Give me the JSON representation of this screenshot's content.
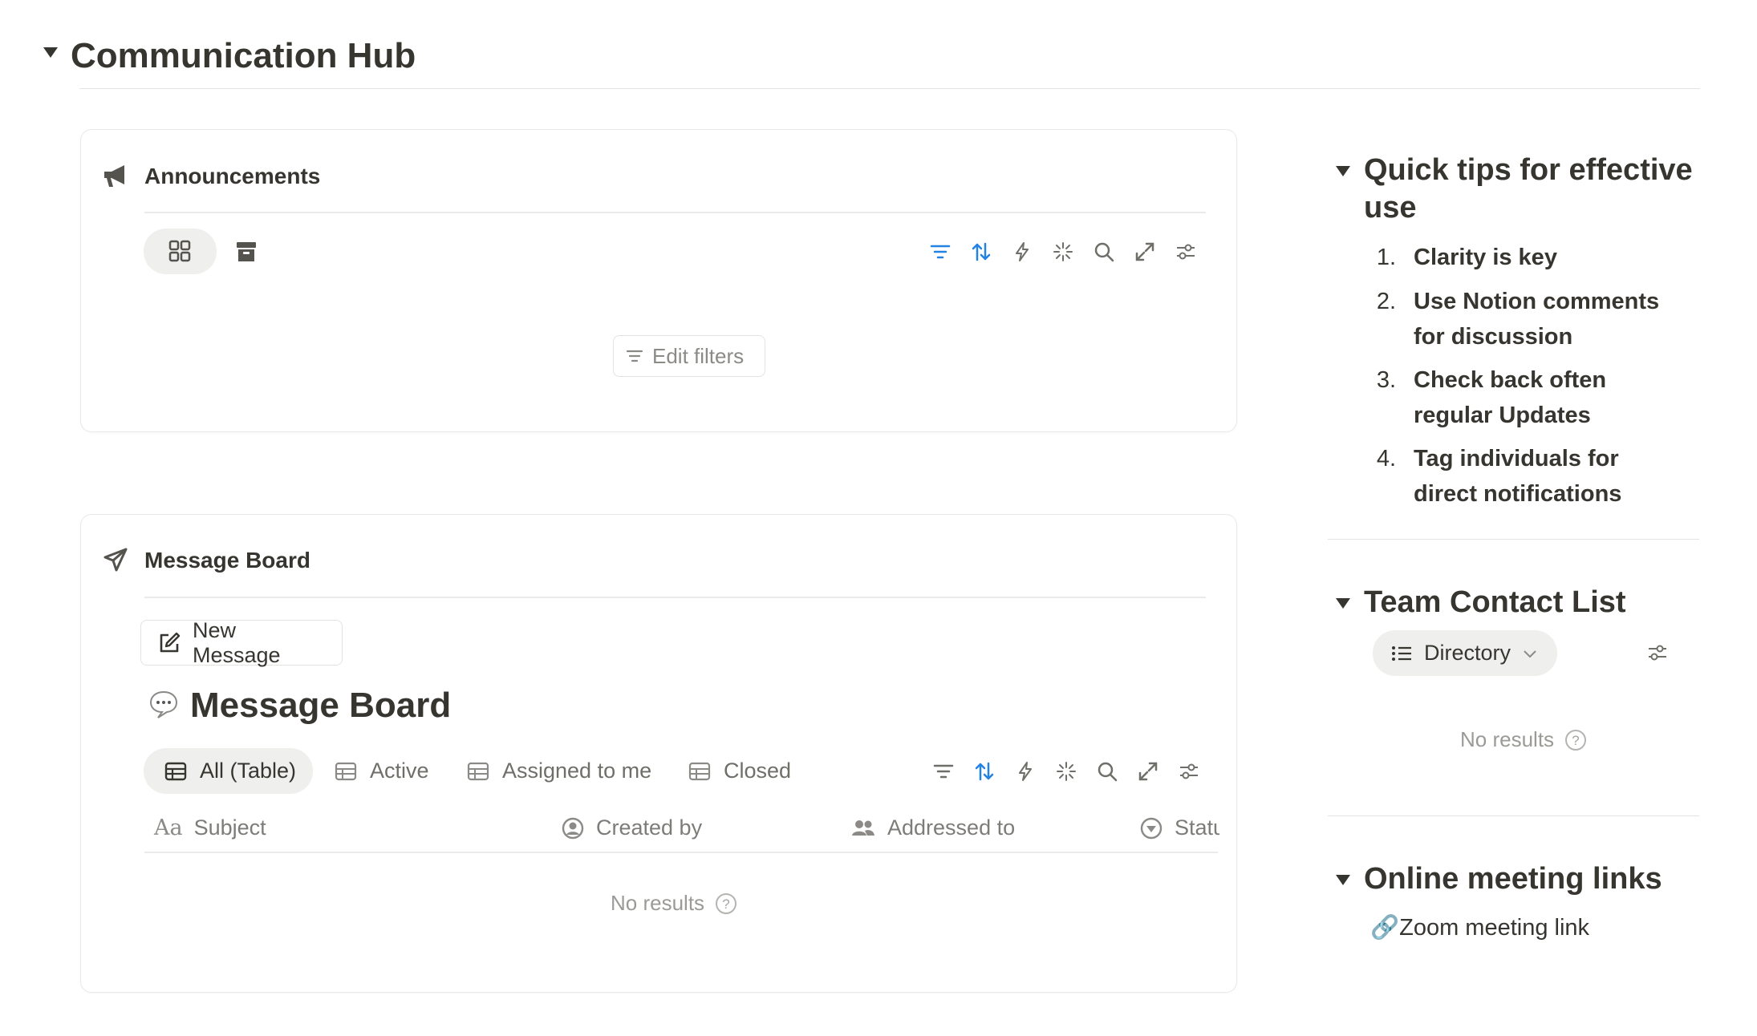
{
  "page": {
    "title": "Communication Hub"
  },
  "announcements": {
    "title": "Announcements",
    "edit_filters_label": "Edit filters"
  },
  "message_board": {
    "title": "Message Board",
    "new_message_label": "New Message",
    "database_title": "Message Board",
    "tabs": [
      {
        "label": "All (Table)",
        "active": true
      },
      {
        "label": "Active",
        "active": false
      },
      {
        "label": "Assigned to me",
        "active": false
      },
      {
        "label": "Closed",
        "active": false
      }
    ],
    "columns": [
      {
        "label": "Subject",
        "icon": "text-property-icon"
      },
      {
        "label": "Created by",
        "icon": "person-circle-icon"
      },
      {
        "label": "Addressed to",
        "icon": "people-icon"
      },
      {
        "label": "Statu",
        "icon": "status-icon"
      }
    ],
    "empty_label": "No results"
  },
  "quick_tips": {
    "title": "Quick tips for effective use",
    "items": [
      {
        "num": "1.",
        "text": "Clarity is key"
      },
      {
        "num": "2.",
        "text": "Use Notion comments for discussion"
      },
      {
        "num": "3.",
        "text": "Check back often regular Updates"
      },
      {
        "num": "4.",
        "text": "Tag individuals for direct notifications"
      }
    ]
  },
  "team_contact": {
    "title": "Team Contact List",
    "view_label": "Directory",
    "empty_label": "No results"
  },
  "meeting_links": {
    "title": "Online meeting links",
    "link_label": "🔗Zoom meeting link"
  },
  "colors": {
    "text": "#37352f",
    "muted": "#9b9a97",
    "accent_blue": "#2383e2",
    "border": "#e9e9e7"
  }
}
